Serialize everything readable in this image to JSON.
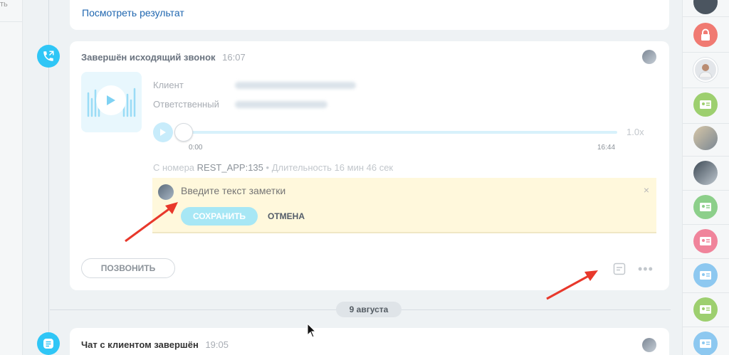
{
  "left_panel": {
    "cut_label": "ть"
  },
  "top_card": {
    "link": "Посмотреть результат"
  },
  "call_card": {
    "title": "Завершён исходящий звонок",
    "time": "16:07",
    "fields": [
      {
        "label": "Клиент"
      },
      {
        "label": "Ответственный"
      }
    ],
    "player": {
      "start": "0:00",
      "end": "16:44",
      "speed": "1.0x"
    },
    "meta": {
      "prefix": "С номера",
      "number": "REST_APP:135",
      "separator": "•",
      "duration": "Длительность 16 мин 46 сек"
    },
    "note": {
      "placeholder": "Введите текст заметки",
      "close": "×",
      "save": "СОХРАНИТЬ",
      "cancel": "ОТМЕНА"
    },
    "call_button": "ПОЗВОНИТЬ"
  },
  "date_separator": "9 августа",
  "chat_card": {
    "title": "Чат с клиентом завершён",
    "time": "19:05"
  },
  "colors": {
    "accent": "#2fc6f6",
    "note_bg": "#fff8dc",
    "arrow": "#e8382b",
    "green": "#9dcf6f",
    "pink": "#f0849b",
    "blue": "#8dc8f0",
    "lock_red": "#f07a72"
  },
  "right_panel": [
    {
      "icon": "user-avatar-icon"
    },
    {
      "icon": "lock-icon"
    },
    {
      "icon": "user-avatar-icon"
    },
    {
      "icon": "contact-card-icon"
    },
    {
      "icon": "user-avatar-icon"
    },
    {
      "icon": "user-avatar-icon"
    },
    {
      "icon": "contact-card-icon"
    },
    {
      "icon": "contact-card-icon"
    },
    {
      "icon": "contact-card-icon"
    },
    {
      "icon": "contact-card-icon"
    },
    {
      "icon": "contact-card-icon"
    }
  ]
}
